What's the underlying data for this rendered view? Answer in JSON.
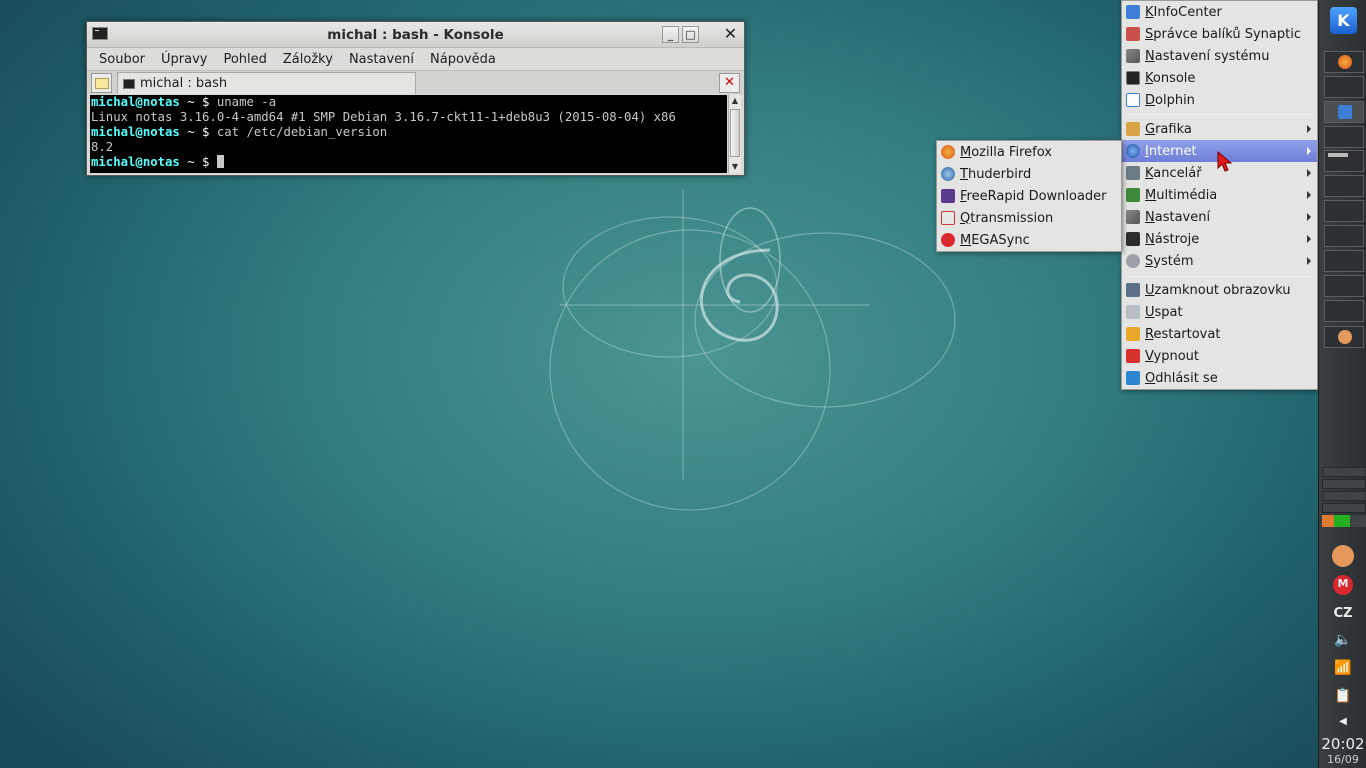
{
  "konsole": {
    "title": "michal : bash - Konsole",
    "menu": [
      "Soubor",
      "Úpravy",
      "Pohled",
      "Záložky",
      "Nastavení",
      "Nápověda"
    ],
    "tab_label": "michal : bash",
    "lines": [
      {
        "user": "michal@notas",
        "path": " ~ $ ",
        "cmd": "uname -a"
      },
      {
        "out": "Linux notas 3.16.0-4-amd64 #1 SMP Debian 3.16.7-ckt11-1+deb8u3 (2015-08-04) x86"
      },
      {
        "user": "michal@notas",
        "path": " ~ $ ",
        "cmd": "cat /etc/debian_version"
      },
      {
        "out": "8.2"
      },
      {
        "user": "michal@notas",
        "path": " ~ $ ",
        "cmd": ""
      }
    ]
  },
  "main_menu": {
    "group1": [
      "KInfoCenter",
      "Správce balíků Synaptic",
      "Nastavení systému",
      "Konsole",
      "Dolphin"
    ],
    "group2": [
      "Grafika",
      "Internet",
      "Kancelář",
      "Multimédia",
      "Nastavení",
      "Nástroje",
      "Systém"
    ],
    "group3": [
      "Uzamknout obrazovku",
      "Uspat",
      "Restartovat",
      "Vypnout",
      "Odhlásit se"
    ],
    "highlighted": "Internet"
  },
  "internet_submenu": [
    "Mozilla Firefox",
    "Thuderbird",
    "FreeRapid Downloader",
    "Qtransmission",
    "MEGASync"
  ],
  "panel": {
    "kbd_layout": "CZ",
    "clock": "20:02",
    "date": "16/09"
  },
  "colors": {
    "menu_highlight": "#7585dc",
    "terminal_prompt": "#54ffff",
    "desktop": "#2f7b7e"
  }
}
